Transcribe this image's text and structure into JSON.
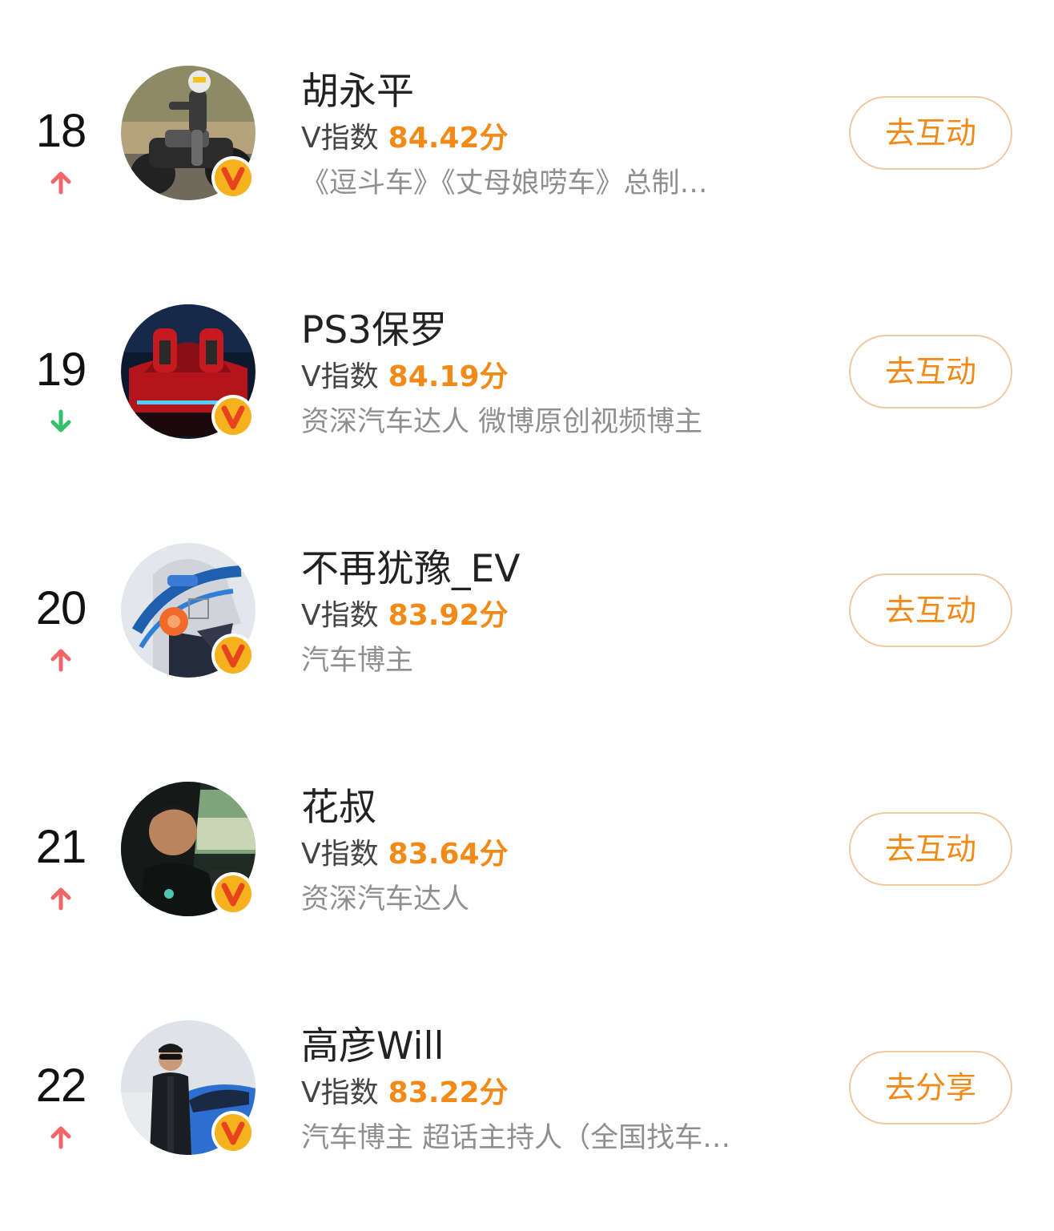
{
  "colors": {
    "accent": "#f28a18",
    "up": "#f06565",
    "down": "#34c06b",
    "badge_fill": "#f5b11e",
    "badge_v": "#e8431f"
  },
  "entries": [
    {
      "rank": "18",
      "trend": "up",
      "trend_icon": "arrow-up-icon",
      "name": "胡永平",
      "score_label": "V指数",
      "score": "84.42分",
      "desc": "《逗斗车》《丈母娘唠车》总制…",
      "action": "去互动",
      "avatar": "motorcycle-rider-photo"
    },
    {
      "rank": "19",
      "trend": "down",
      "trend_icon": "arrow-down-icon",
      "name": "PS3保罗",
      "score_label": "V指数",
      "score": "84.19分",
      "desc": "资深汽车达人 微博原创视频博主",
      "action": "去互动",
      "avatar": "red-car-photo"
    },
    {
      "rank": "20",
      "trend": "up",
      "trend_icon": "arrow-up-icon",
      "name": "不再犹豫_EV",
      "score_label": "V指数",
      "score": "83.92分",
      "desc": "汽车博主",
      "action": "去互动",
      "avatar": "ev-tech-head-graphic"
    },
    {
      "rank": "21",
      "trend": "up",
      "trend_icon": "arrow-up-icon",
      "name": "花叔",
      "score_label": "V指数",
      "score": "83.64分",
      "desc": "资深汽车达人",
      "action": "去互动",
      "avatar": "driver-portrait-photo"
    },
    {
      "rank": "22",
      "trend": "up",
      "trend_icon": "arrow-up-icon",
      "name": "高彦Will",
      "score_label": "V指数",
      "score": "83.22分",
      "desc": "汽车博主 超话主持人（全国找车…",
      "action": "去分享",
      "avatar": "man-with-blue-car-photo"
    }
  ]
}
